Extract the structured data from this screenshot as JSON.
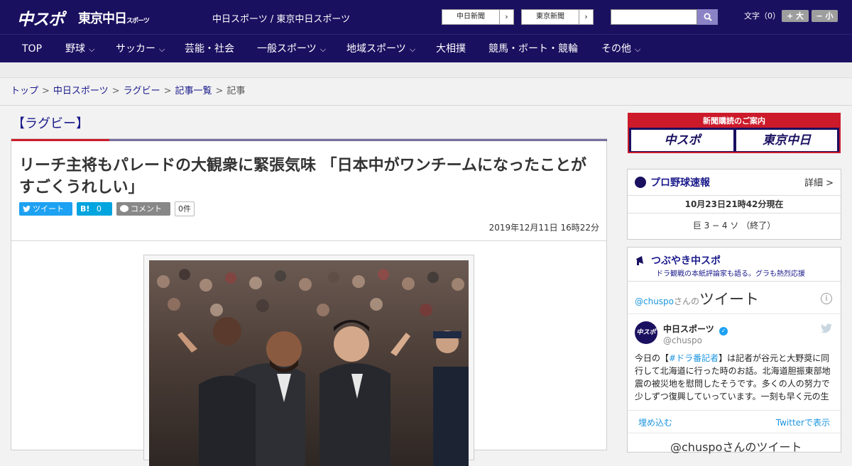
{
  "header": {
    "logo_main": "中スポ",
    "logo_tokyo": "東京中日",
    "logo_tokyo_small": "スポーツ",
    "site_title": "中日スポーツ / 東京中日スポーツ",
    "newspaper_buttons": [
      "中日新聞",
      "東京新聞"
    ],
    "search_placeholder": "",
    "font_size_label": "文字（0）",
    "font_plus": "+ 大",
    "font_minus": "− 小"
  },
  "nav": {
    "items": [
      {
        "label": "TOP",
        "dropdown": false
      },
      {
        "label": "野球",
        "dropdown": true
      },
      {
        "label": "サッカー",
        "dropdown": true
      },
      {
        "label": "芸能・社会",
        "dropdown": false
      },
      {
        "label": "一般スポーツ",
        "dropdown": true
      },
      {
        "label": "地域スポーツ",
        "dropdown": true
      },
      {
        "label": "大相撲",
        "dropdown": false
      },
      {
        "label": "競馬・ボート・競輪",
        "dropdown": false
      },
      {
        "label": "その他",
        "dropdown": true
      }
    ]
  },
  "breadcrumb": {
    "items": [
      "トップ",
      "中日スポーツ",
      "ラグビー",
      "記事一覧"
    ],
    "current": "記事"
  },
  "article": {
    "category": "【ラグビー】",
    "headline": "リーチ主将もパレードの大観衆に緊張気味 「日本中がワンチームになったことがすごくうれしい」",
    "tweet_label": "ツイート",
    "hatena_label": "B!",
    "hatena_count": "0",
    "comment_label": "コメント",
    "comment_count": "0件",
    "date": "2019年12月11日 16時22分"
  },
  "sidebar": {
    "subscribe": {
      "title": "新聞購読のご案内",
      "left": "中スポ",
      "right": "東京中日"
    },
    "scores": {
      "title": "プロ野球速報",
      "detail": "詳細 >",
      "time": "10月23日21時42分現在",
      "game": "巨 3 − 4 ソ （終了）"
    },
    "tweets": {
      "title": "つぶやき中スポ",
      "subtitle": "ドラ観戦の本紙評論家も語る。グラも熱烈応援",
      "handle_prefix": "@chuspo",
      "handle_suffix": "さんの",
      "tweet_word": "ツイート",
      "user_name": "中日スポーツ",
      "user_handle": "@chuspo",
      "avatar_text": "中スポ",
      "text_before": "今日の【",
      "hashtag": "#ドラ番記者",
      "text_after": "】は記者が谷元と大野奨に同行して北海道に行った時のお話。北海道胆振東部地震の被災地を慰問したそうです。多くの人の努力で少しずつ復興していっています。一刻も早く元の生",
      "embed": "埋め込む",
      "view_on": "Twitterで表示",
      "next": "@chuspoさんのツイート"
    }
  },
  "colors": {
    "header_bg": "#1a1060",
    "accent_red": "#cc1a2a",
    "link": "#1a1a8c",
    "twitter": "#1da1f2"
  }
}
